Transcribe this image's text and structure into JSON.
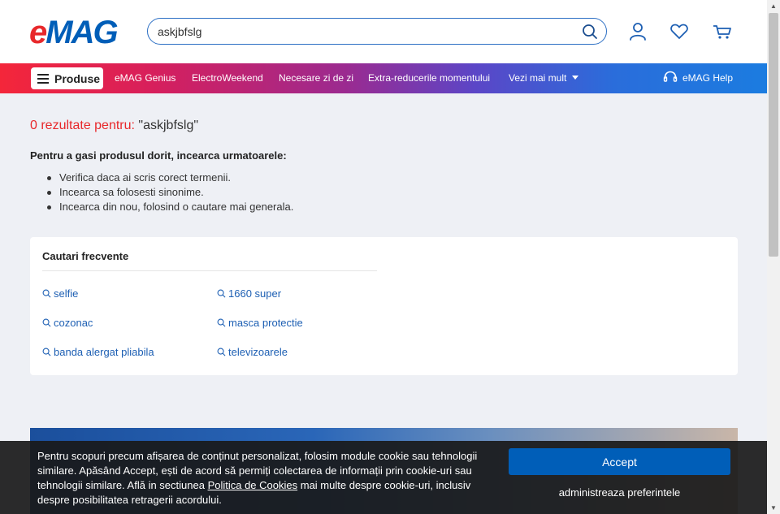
{
  "header": {
    "logo_e": "e",
    "logo_mag": "MAG",
    "search": {
      "value": "askjbfslg"
    }
  },
  "nav": {
    "produse_label": "Produse",
    "items": [
      "eMAG Genius",
      "ElectroWeekend",
      "Necesare zi de zi",
      "Extra-reducerile momentului",
      "Vezi mai mult"
    ],
    "help_label": "eMAG Help"
  },
  "results": {
    "count_text": "0 rezultate pentru:",
    "query_text": "\"askjbfslg\""
  },
  "tips": {
    "title": "Pentru a gasi produsul dorit, incearca urmatoarele:",
    "items": [
      "Verifica daca ai scris corect termenii.",
      "Incearca sa folosesti sinonime.",
      "Incearca din nou, folosind o cautare mai generala."
    ]
  },
  "frequent": {
    "title": "Cautari frecvente",
    "items": [
      "selfie",
      "1660 super",
      "cozonac",
      "masca protectie",
      "banda alergat pliabila",
      "televizoarele"
    ]
  },
  "cookie": {
    "text_before": "Pentru scopuri precum afișarea de conținut personalizat, folosim module cookie sau tehnologii similare. Apăsând Accept, ești de acord să permiți colectarea de informații prin cookie-uri sau tehnologii similare. Află in sectiunea ",
    "link": "Politica de Cookies",
    "text_after": " mai multe despre cookie-uri, inclusiv despre posibilitatea retragerii acordului.",
    "accept_label": "Accept",
    "manage_label": "administreaza preferintele"
  },
  "colors": {
    "brand_red": "#e8282b",
    "brand_blue": "#005eb8",
    "link_blue": "#1d5fb3"
  }
}
